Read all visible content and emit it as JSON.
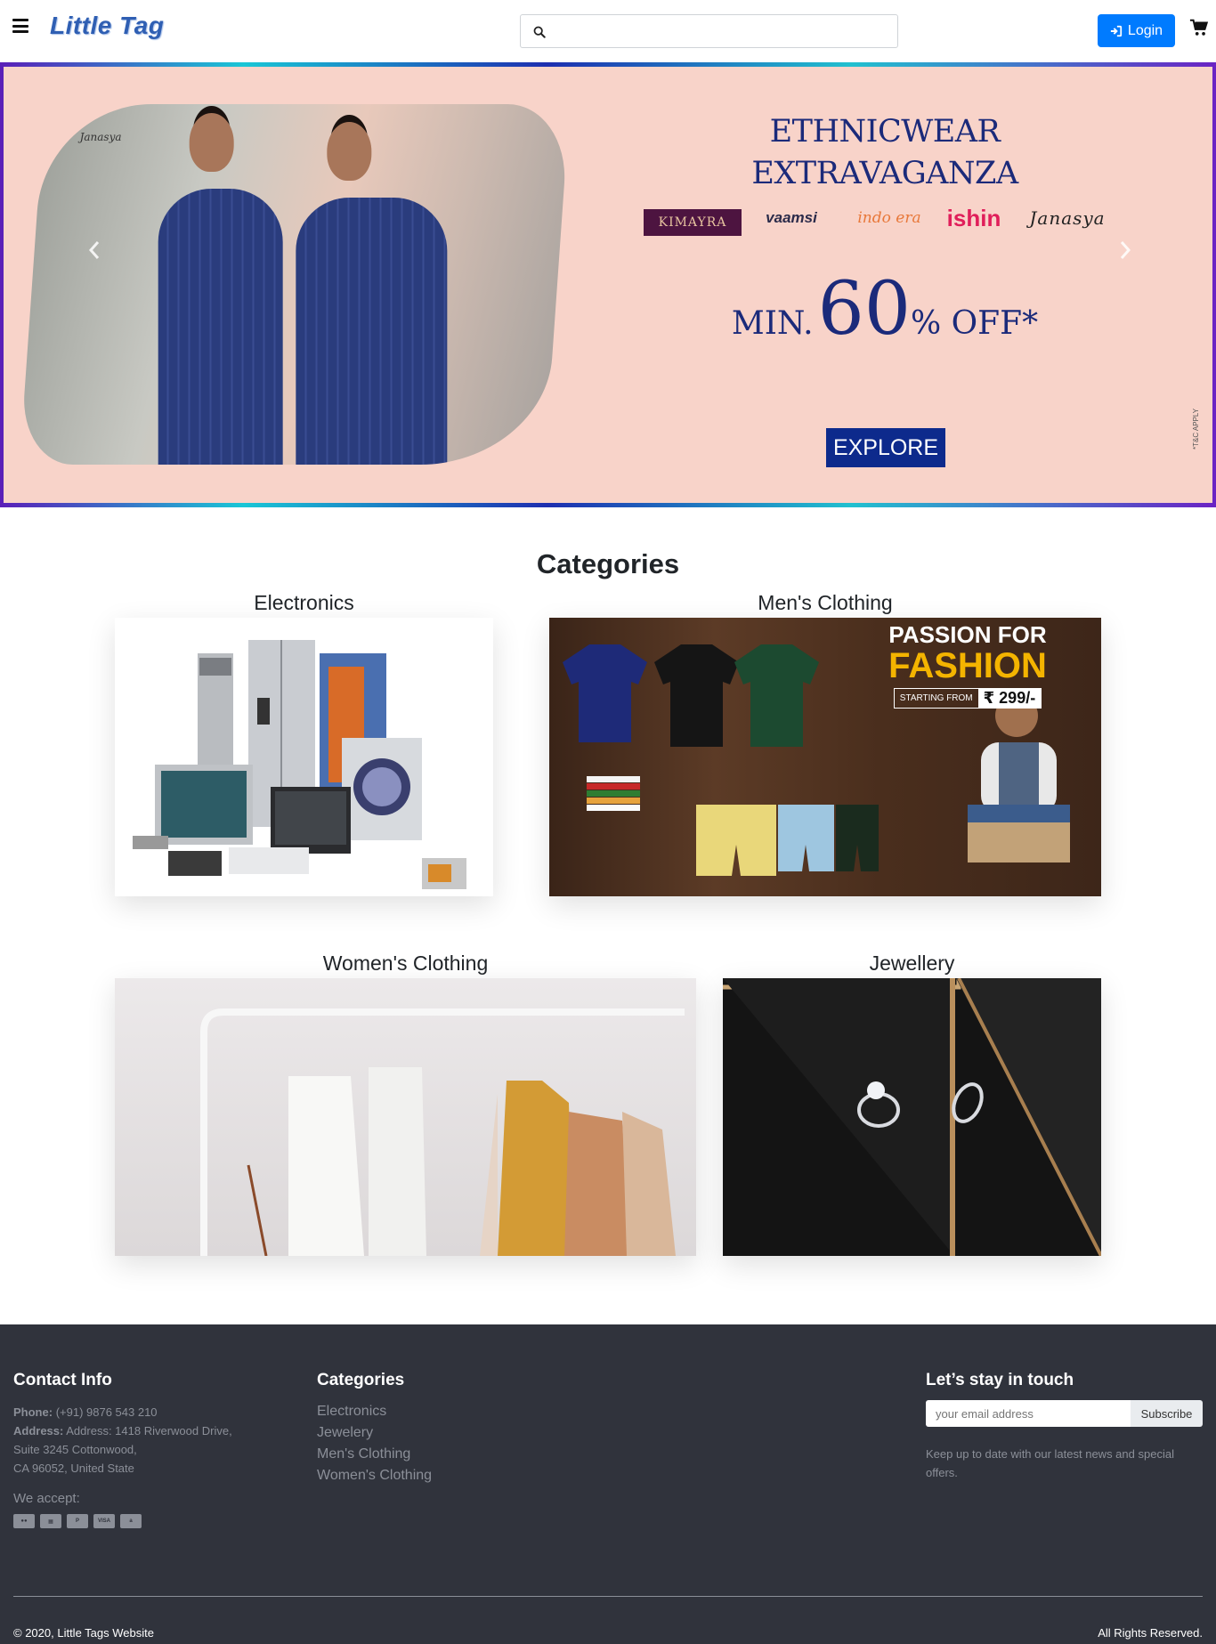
{
  "navbar": {
    "brand": "Little Tag",
    "search_placeholder": "",
    "login_label": "Login"
  },
  "hero": {
    "photo_brand": "Janasya",
    "title_line1": "ETHNICWEAR",
    "title_line2": "EXTRAVAGANZA",
    "brands": [
      "KIMAYRA",
      "vaamsi",
      "indo era",
      "ishin",
      "Janasya"
    ],
    "offer_prefix": "MIN.",
    "offer_value": "60",
    "offer_suffix": "% OFF*",
    "cta_label": "EXPLORE",
    "terms": "*T&C APPLY"
  },
  "categories": {
    "heading": "Categories",
    "items": [
      {
        "label": "Electronics"
      },
      {
        "label": "Men's Clothing",
        "promo_line1": "PASSION FOR",
        "promo_line2": "FASHION",
        "promo_price_prefix": "STARTING FROM",
        "promo_price": "₹ 299/-"
      },
      {
        "label": "Women's Clothing"
      },
      {
        "label": "Jewellery"
      }
    ]
  },
  "footer": {
    "contact": {
      "heading": "Contact Info",
      "phone_label": "Phone:",
      "phone": "(+91) 9876 543 210",
      "address_label": "Address:",
      "address_line1": "Address: 1418 Riverwood Drive,",
      "address_line2": "Suite 3245 Cottonwood,",
      "address_line3": "CA 96052, United State",
      "accept_label": "We accept:"
    },
    "categories": {
      "heading": "Categories",
      "links": [
        "Electronics",
        "Jewelery",
        "Men's Clothing",
        "Women's Clothing"
      ]
    },
    "newsletter": {
      "heading": "Let’s stay in touch",
      "email_placeholder": "your email address",
      "subscribe_label": "Subscribe",
      "note_line1": "Keep up to date with our latest news and special",
      "note_line2": "offers."
    },
    "copyright": "© 2020, Little Tags Website",
    "rights": "All Rights Reserved."
  },
  "colors": {
    "primary": "#007bff",
    "footer_bg": "#30333c",
    "hero_bg": "#f8d3c9",
    "hero_text": "#1b2a7a",
    "brand": "#2f5fb3"
  },
  "icons": {
    "menu": "hamburger-icon",
    "search": "search-icon",
    "login": "sign-in-icon",
    "cart": "shopping-cart-icon",
    "payments": [
      "mastercard-icon",
      "card-icon",
      "paypal-icon",
      "visa-icon",
      "amazon-icon"
    ]
  }
}
